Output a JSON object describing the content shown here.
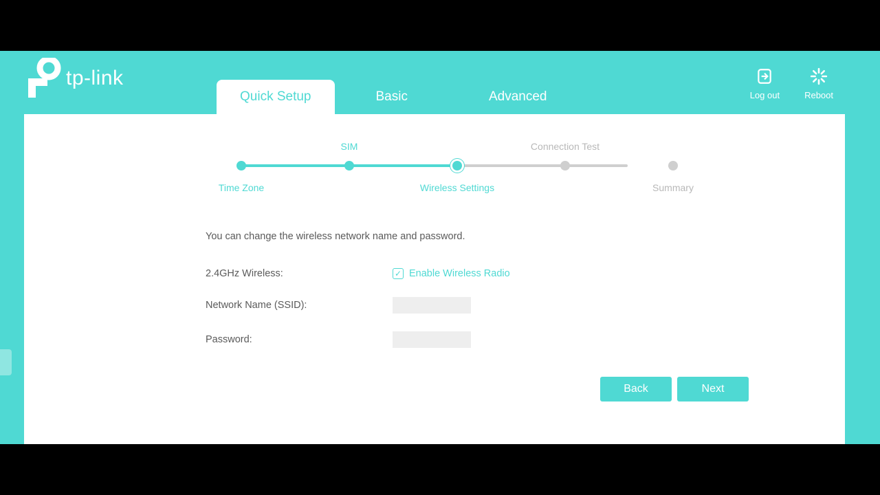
{
  "brand": {
    "name": "tp-link"
  },
  "nav": {
    "tabs": [
      {
        "label": "Quick Setup",
        "active": true
      },
      {
        "label": "Basic",
        "active": false
      },
      {
        "label": "Advanced",
        "active": false
      }
    ]
  },
  "actions": {
    "logout": "Log out",
    "reboot": "Reboot"
  },
  "stepper": {
    "steps": [
      {
        "label": "Time Zone",
        "pos": "bot",
        "state": "done"
      },
      {
        "label": "SIM",
        "pos": "top",
        "state": "done"
      },
      {
        "label": "Wireless Settings",
        "pos": "bot",
        "state": "current"
      },
      {
        "label": "Connection Test",
        "pos": "top",
        "state": "todo"
      },
      {
        "label": "Summary",
        "pos": "bot",
        "state": "todo"
      }
    ]
  },
  "form": {
    "description": "You can change the wireless network name and password.",
    "wireless_label": "2.4GHz Wireless:",
    "enable_radio_label": "Enable Wireless Radio",
    "enable_radio_checked": true,
    "ssid_label": "Network Name (SSID):",
    "ssid_value": "",
    "password_label": "Password:",
    "password_value": ""
  },
  "buttons": {
    "back": "Back",
    "next": "Next"
  },
  "colors": {
    "accent": "#4fd9d3",
    "inactive": "#b8b8b8"
  }
}
